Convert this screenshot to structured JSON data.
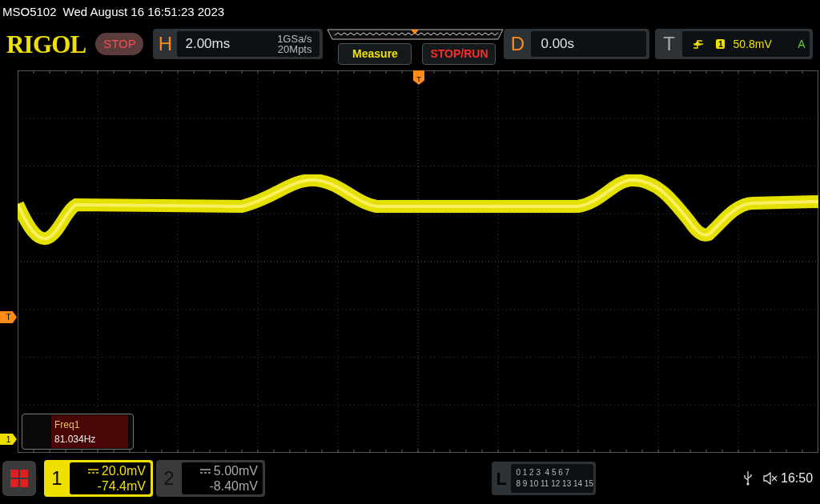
{
  "status": {
    "model": "MSO5102",
    "datetime": "Wed August 16 16:51:23 2023"
  },
  "toolbar": {
    "logo": "RIGOL",
    "run_state": "STOP",
    "horizontal": {
      "label": "H",
      "timebase": "2.00ms",
      "sample_rate": "1GSa/s",
      "memory_depth": "20Mpts"
    },
    "buttons": [
      {
        "label": "Measure",
        "kind": "measure"
      },
      {
        "label": "STOP/RUN",
        "kind": "stoprun"
      }
    ],
    "delay": {
      "label": "D",
      "value": "0.00s"
    },
    "trigger": {
      "label": "T",
      "source": "1",
      "level": "50.8mV",
      "mode": "A"
    }
  },
  "markers": {
    "trigger_position": "T",
    "trigger_level": "T",
    "channel_1": "1"
  },
  "measurement": {
    "name": "Freq1",
    "value": "81.034Hz"
  },
  "channels": [
    {
      "number": "1",
      "scale": "20.0mV",
      "offset": "-74.4mV",
      "active": true
    },
    {
      "number": "2",
      "scale": "5.00mV",
      "offset": "-8.40mV",
      "active": false
    }
  ],
  "logic": {
    "label": "L",
    "rows": [
      "0 1 2 3  4 5 6 7",
      "8 9 10 11 12 13 14 15"
    ]
  },
  "clock": "16:50"
}
